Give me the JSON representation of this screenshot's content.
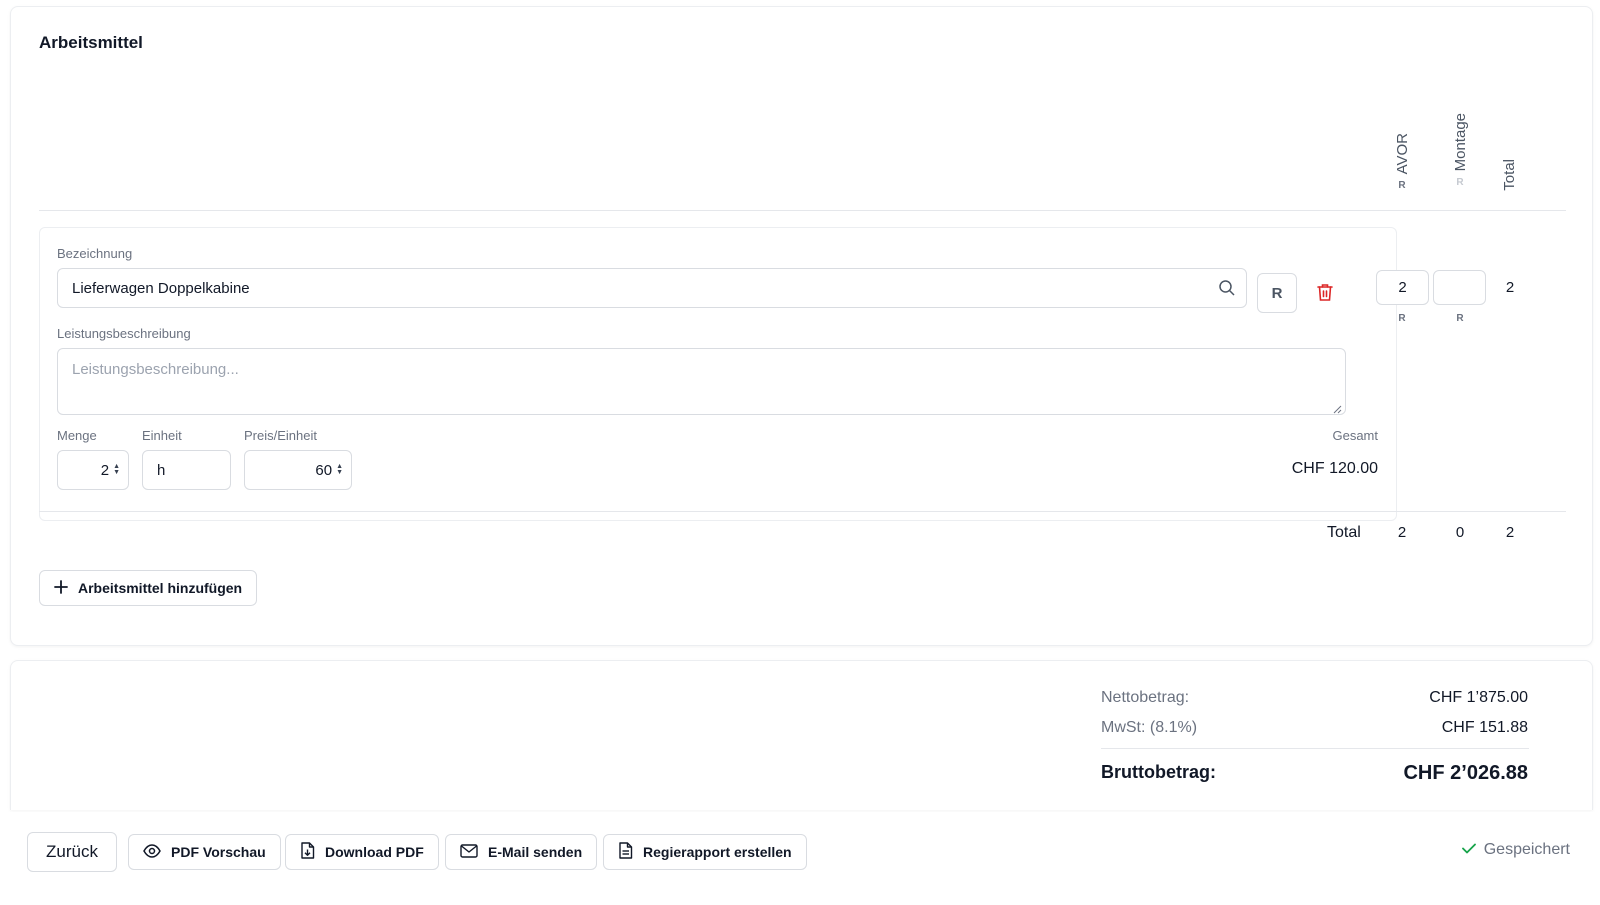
{
  "section": {
    "title": "Arbeitsmittel",
    "columns": [
      {
        "label": "AVOR",
        "badge": "R"
      },
      {
        "label": "Montage",
        "badge": "R"
      },
      {
        "label": "Total"
      }
    ]
  },
  "item": {
    "bezeichnung_label": "Bezeichnung",
    "bezeichnung_value": "Lieferwagen Doppelkabine",
    "r_button": "R",
    "beschreibung_label": "Leistungsbeschreibung",
    "beschreibung_placeholder": "Leistungsbeschreibung...",
    "menge_label": "Menge",
    "menge_value": "2",
    "einheit_label": "Einheit",
    "einheit_value": "h",
    "preis_label": "Preis/Einheit",
    "preis_value": "60",
    "gesamt_label": "Gesamt",
    "gesamt_value": "CHF 120.00",
    "avor_value": "2",
    "montage_value": "",
    "avor_badge": "R",
    "montage_badge": "R",
    "total_value": "2"
  },
  "totals_row": {
    "label": "Total",
    "avor": "2",
    "montage": "0",
    "total": "2"
  },
  "add_button": "Arbeitsmittel hinzufügen",
  "summary": {
    "netto_label": "Nettobetrag:",
    "netto_value": "CHF 1’875.00",
    "mwst_label": "MwSt: (8.1%)",
    "mwst_value": "CHF 151.88",
    "brutto_label": "Bruttobetrag:",
    "brutto_value": "CHF 2’026.88"
  },
  "toolbar": {
    "back": "Zurück",
    "pdf_preview": "PDF Vorschau",
    "download_pdf": "Download PDF",
    "email": "E-Mail senden",
    "regierapport": "Regierapport erstellen",
    "saved": "Gespeichert"
  },
  "colors": {
    "danger": "#dc2626",
    "success": "#16a34a",
    "border": "#d9dce1",
    "muted_text": "#6b7280"
  }
}
